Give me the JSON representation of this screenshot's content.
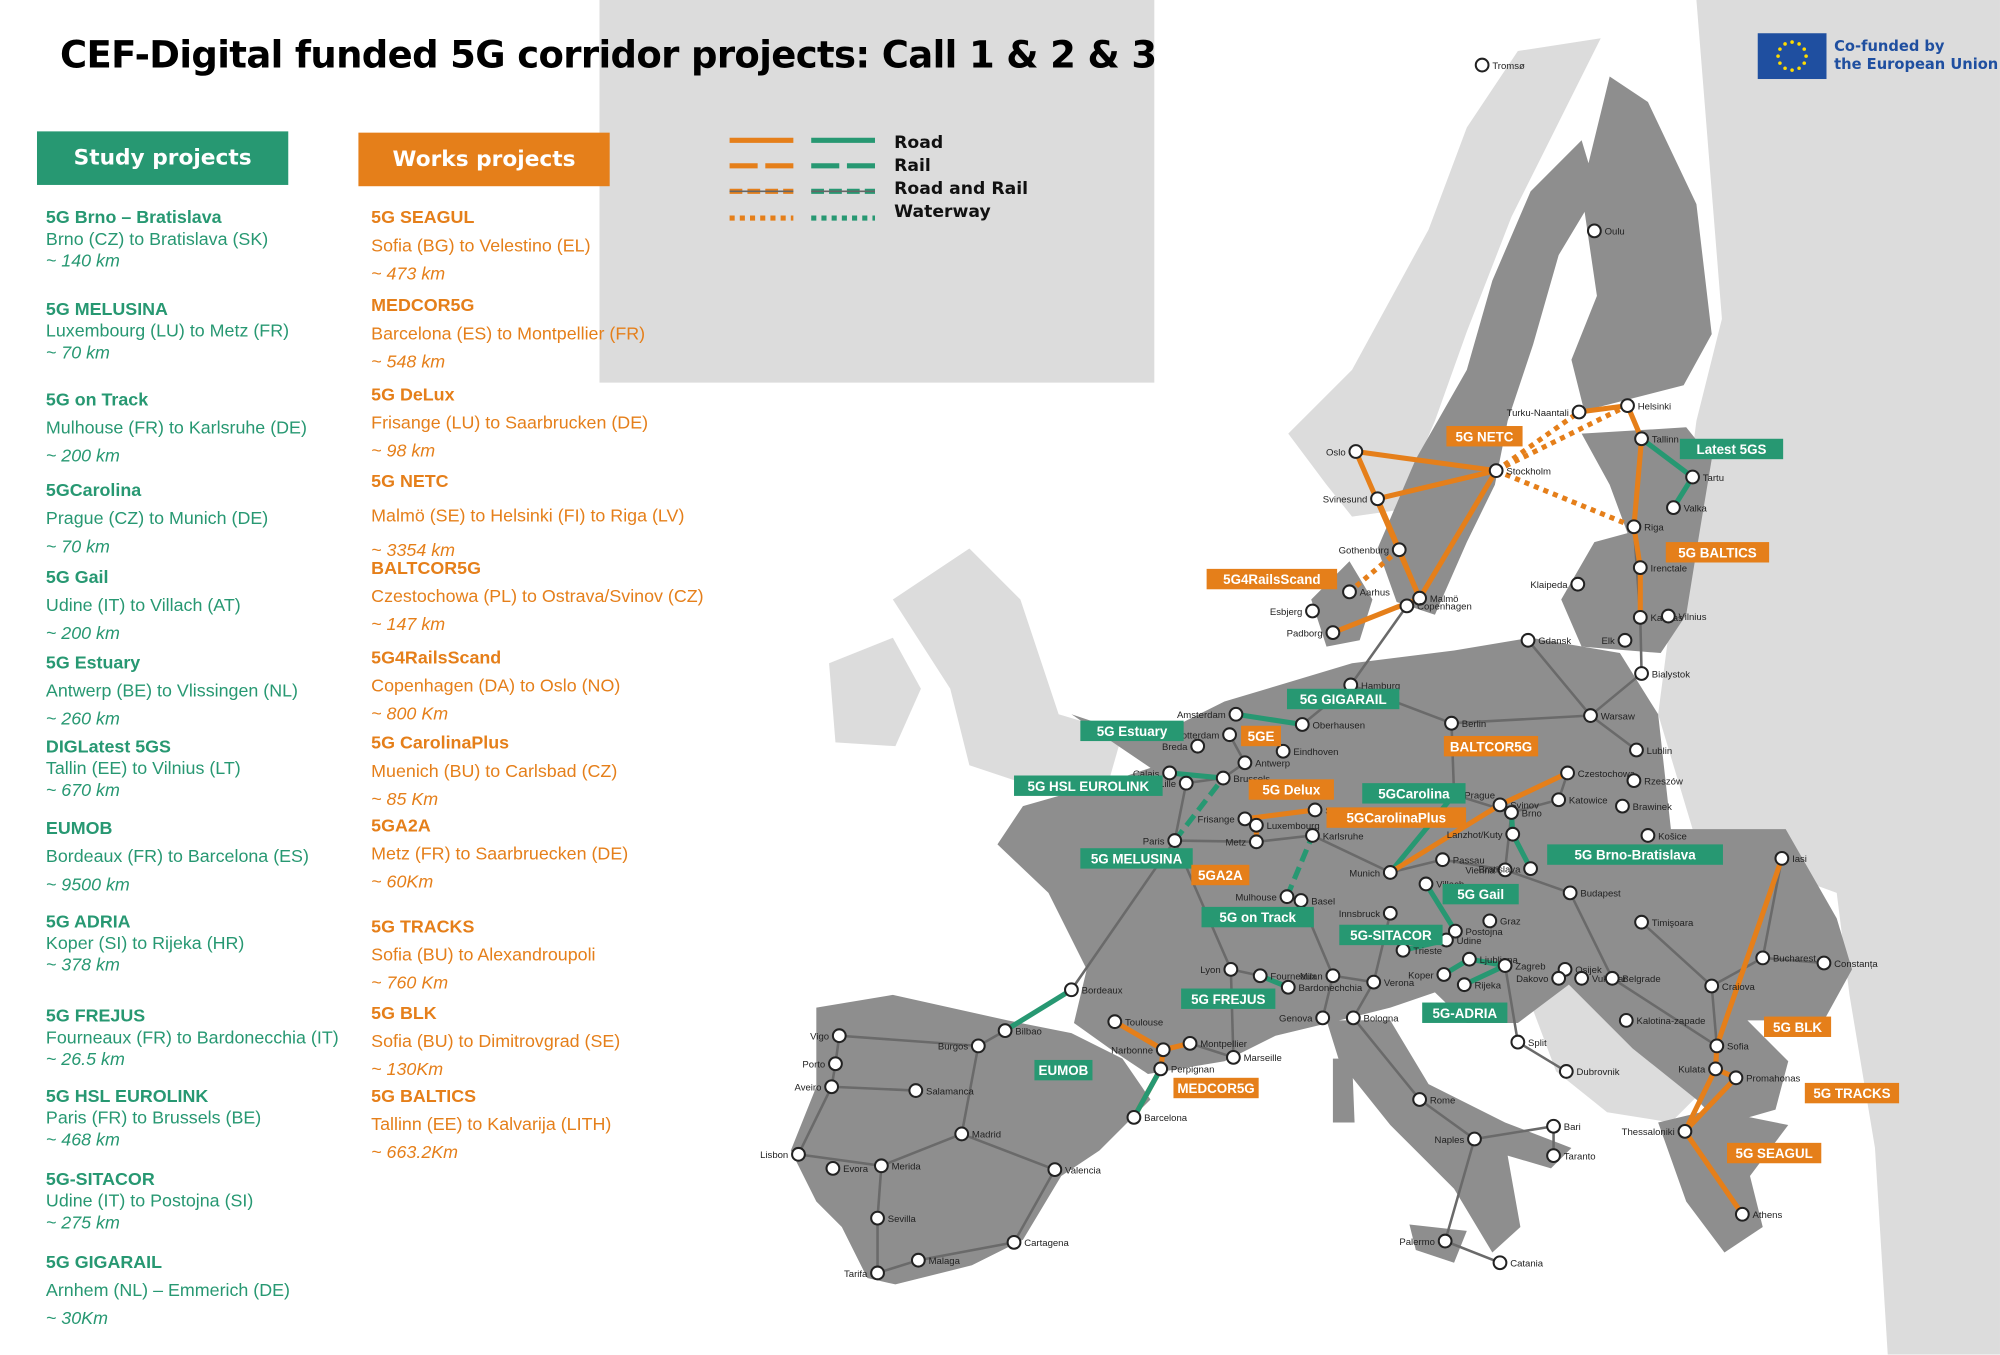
{
  "title": "CEF-Digital funded 5G corridor projects: Call 1 & 2 & 3",
  "colors": {
    "study": "#279872",
    "works": "#e57f1a",
    "eu_member": "#8e8e8e",
    "non_eu": "#dcdcdc",
    "eu_flag": "#1f4fa0",
    "eu_star": "#ffdd00"
  },
  "headers": {
    "study": "Study projects",
    "works": "Works projects"
  },
  "legend": {
    "items": [
      "Road",
      "Rail",
      "Road and Rail",
      "Waterway"
    ]
  },
  "eu_logo": {
    "line1": "Co-funded by",
    "line2": "the European Union",
    "icon": "eu-flag-icon"
  },
  "study_projects": [
    {
      "name": "5G Brno – Bratislava",
      "route": "Brno (CZ) to Bratislava (SK)",
      "length": "~ 140 km"
    },
    {
      "name": "5G MELUSINA",
      "route": "Luxembourg (LU) to Metz (FR)",
      "length": "~ 70 km"
    },
    {
      "name": "5G on Track",
      "route": "Mulhouse (FR) to Karlsruhe (DE)",
      "length": "~ 200 km"
    },
    {
      "name": "5GCarolina",
      "route": "Prague (CZ) to Munich (DE)",
      "length": "~ 70 km"
    },
    {
      "name": "5G Gail",
      "route": "Udine (IT) to Villach (AT)",
      "length": "~ 200 km"
    },
    {
      "name": "5G Estuary",
      "route": "Antwerp (BE) to Vlissingen (NL)",
      "length": "~ 260 km"
    },
    {
      "name": "DIGLatest 5GS",
      "route": "Tallin (EE) to Vilnius (LT)",
      "length": "~ 670 km"
    },
    {
      "name": "EUMOB",
      "route": "Bordeaux (FR) to Barcelona (ES)",
      "length": "~ 9500 km"
    },
    {
      "name": "5G ADRIA",
      "route": "Koper (SI) to Rijeka (HR)",
      "length": "~ 378 km"
    },
    {
      "name": "5G FREJUS",
      "route": "Fourneaux (FR) to Bardonecchia  (IT)",
      "length": "~ 26.5 km"
    },
    {
      "name": "5G HSL EUROLINK",
      "route": "Paris (FR) to Brussels (BE)",
      "length": "~ 468 km"
    },
    {
      "name": "5G-SITACOR",
      "route": "Udine (IT) to Postojna (SI)",
      "length": "~ 275 km"
    },
    {
      "name": "5G GIGARAIL",
      "route": "Arnhem (NL) – Emmerich (DE)",
      "length": "~ 30Km"
    }
  ],
  "works_projects": [
    {
      "name": "5G SEAGUL",
      "route": "Sofia (BG) to Velestino (EL)",
      "length": "~ 473 km"
    },
    {
      "name": "MEDCOR5G",
      "route": "Barcelona (ES) to Montpellier (FR)",
      "length": "~ 548 km"
    },
    {
      "name": "5G DeLux",
      "route": "Frisange (LU) to Saarbrucken (DE)",
      "length": "~ 98 km"
    },
    {
      "name": "5G NETC",
      "route": "Malmö (SE) to Helsinki (FI) to Riga (LV)",
      "length": "~ 3354 km"
    },
    {
      "name": "BALTCOR5G",
      "route": "Czestochowa (PL) to Ostrava/Svinov (CZ)",
      "length": "~ 147 km"
    },
    {
      "name": "5G4RailsScand",
      "route": "Copenhagen (DA) to Oslo (NO)",
      "length": "~ 800 Km"
    },
    {
      "name": "5G CarolinaPlus",
      "route": "Muenich (BU) to Carlsbad (CZ)",
      "length": "~ 85 Km"
    },
    {
      "name": "5GA2A",
      "route": "Metz (FR) to Saarbruecken (DE)",
      "length": "~ 60Km"
    },
    {
      "name": "5G TRACKS",
      "route": "Sofia (BU) to Alexandroupoli",
      "length": "~ 760 Km"
    },
    {
      "name": "5G BLK",
      "route": "Sofia (BU) to Dimitrovgrad (SE)",
      "length": "~ 130Km"
    },
    {
      "name": "5G BALTICS",
      "route": "Tallinn (EE) to Kalvarija (LITH)",
      "length": "~ 663.2Km"
    }
  ],
  "map": {
    "cities": [
      "Tromsø",
      "Oulu",
      "Helsinki",
      "Turku-Naantali",
      "Oslo",
      "Stockholm",
      "Svinesund",
      "Gothenburg",
      "Malmö",
      "Copenhagen",
      "Aarhus",
      "Esbjerg",
      "Padborg",
      "Tallinn",
      "Tartu",
      "Valka",
      "Riga",
      "Irenctale",
      "Klaipeda",
      "Kaunas",
      "Vilnius",
      "Elk",
      "Gdansk",
      "Bialystok",
      "Hamburg",
      "Berlin",
      "Warsaw",
      "Lublin",
      "Czestochowa",
      "Katowice",
      "Rzeszów",
      "Brawinek",
      "Košice",
      "Amsterdam",
      "Rotterdam",
      "Breda",
      "Eindhoven",
      "Oberhausen",
      "Calais",
      "Lille",
      "Brussels",
      "Antwerp",
      "Paris",
      "Luxembourg",
      "Frisange",
      "Metz",
      "Saarbrucken",
      "Karlsruhe",
      "Prague",
      "Svinov",
      "Brno",
      "Lanzhot/Kuty",
      "Passau",
      "Munich",
      "Villach",
      "Vienna",
      "Bratislava",
      "Mulhouse",
      "Basel",
      "Innsbruck",
      "Graz",
      "Postojna",
      "Udine",
      "Trieste",
      "Ljubljana",
      "Koper",
      "Rijeka",
      "Zagreb",
      "Budapest",
      "Osijek",
      "Dakovo",
      "Vukovar",
      "Belgrade",
      "Timişoara",
      "Iasi",
      "Bucharest",
      "Constanța",
      "Craiova",
      "Kalotina-zapade",
      "Sofia",
      "Kulata",
      "Promahonas",
      "Thessaloniki",
      "Athens",
      "Lyon",
      "Fourneaux",
      "Bardonechchia",
      "Milan",
      "Verona",
      "Genova",
      "Bologna",
      "Bordeaux",
      "Bilbao",
      "Burgos",
      "Vigo",
      "Porto",
      "Aveiro",
      "Salamanca",
      "Madrid",
      "Lisbon",
      "Evora",
      "Merida",
      "Sevilla",
      "Tarifa",
      "Malaga",
      "Cartagena",
      "Valencia",
      "Barcelona",
      "Perpignan",
      "Narbonne",
      "Montpellier",
      "Toulouse",
      "Marseille",
      "Rome",
      "Naples",
      "Bari",
      "Taranto",
      "Palermo",
      "Catania",
      "Split",
      "Dubrovnik"
    ],
    "project_tags": [
      {
        "label": "5G NETC",
        "type": "works"
      },
      {
        "label": "Latest 5GS",
        "type": "study"
      },
      {
        "label": "5G BALTICS",
        "type": "works"
      },
      {
        "label": "5G4RailsScand",
        "type": "works"
      },
      {
        "label": "5G GIGARAIL",
        "type": "study"
      },
      {
        "label": "5G Estuary",
        "type": "study"
      },
      {
        "label": "5GE",
        "type": "works"
      },
      {
        "label": "BALTCOR5G",
        "type": "works"
      },
      {
        "label": "5G HSL EUROLINK",
        "type": "study"
      },
      {
        "label": "5G Delux",
        "type": "works"
      },
      {
        "label": "5GCarolina",
        "type": "study"
      },
      {
        "label": "5GCarolinaPlus",
        "type": "works"
      },
      {
        "label": "5G Brno-Bratislava",
        "type": "study"
      },
      {
        "label": "5G MELUSINA",
        "type": "study"
      },
      {
        "label": "5GA2A",
        "type": "works"
      },
      {
        "label": "5G Gail",
        "type": "study"
      },
      {
        "label": "5G on Track",
        "type": "study"
      },
      {
        "label": "5G-SITACOR",
        "type": "study"
      },
      {
        "label": "5G FREJUS",
        "type": "study"
      },
      {
        "label": "5G-ADRIA",
        "type": "study"
      },
      {
        "label": "5G BLK",
        "type": "works"
      },
      {
        "label": "EUMOB",
        "type": "study"
      },
      {
        "label": "MEDCOR5G",
        "type": "works"
      },
      {
        "label": "5G TRACKS",
        "type": "works"
      },
      {
        "label": "5G SEAGUL",
        "type": "works"
      }
    ]
  }
}
